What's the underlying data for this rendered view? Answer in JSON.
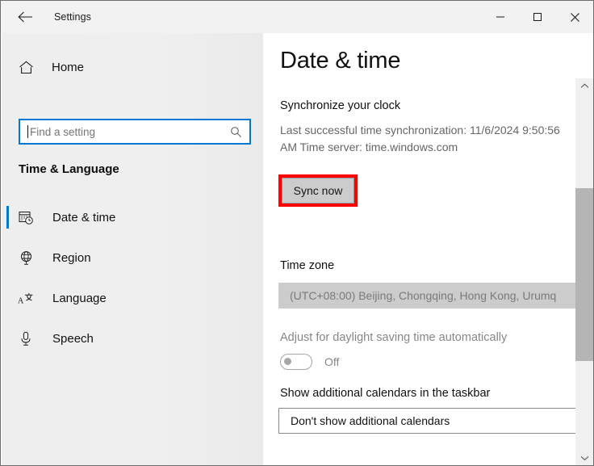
{
  "window": {
    "app_title": "Settings",
    "back_icon": "back-arrow-icon",
    "minimize_label": "—",
    "maximize_label": "□",
    "close_label": "✕"
  },
  "sidebar": {
    "home": {
      "label": "Home",
      "icon": "home-icon"
    },
    "search": {
      "placeholder": "Find a setting",
      "icon": "search-icon"
    },
    "category_title": "Time & Language",
    "items": [
      {
        "label": "Date & time",
        "icon": "calendar-clock-icon",
        "selected": true
      },
      {
        "label": "Region",
        "icon": "globe-icon",
        "selected": false
      },
      {
        "label": "Language",
        "icon": "language-icon",
        "selected": false
      },
      {
        "label": "Speech",
        "icon": "microphone-icon",
        "selected": false
      }
    ]
  },
  "content": {
    "page_title": "Date & time",
    "sync": {
      "heading": "Synchronize your clock",
      "info": "Last successful time synchronization: 11/6/2024 9:50:56 AM\nTime server: time.windows.com",
      "button_label": "Sync now",
      "highlight_color": "#ff0000"
    },
    "timezone": {
      "heading": "Time zone",
      "value": "(UTC+08:00) Beijing, Chongqing, Hong Kong, Urumq"
    },
    "daylight_saving": {
      "label": "Adjust for daylight saving time automatically",
      "state": "Off"
    },
    "calendars": {
      "heading": "Show additional calendars in the taskbar",
      "value": "Don't show additional calendars"
    }
  },
  "scrollbar": {
    "up_icon": "chevron-up-icon",
    "down_icon": "chevron-down-icon"
  },
  "colors": {
    "accent": "#0078d7",
    "sidebar_bg": "#efefef",
    "highlight": "#ff0000"
  }
}
